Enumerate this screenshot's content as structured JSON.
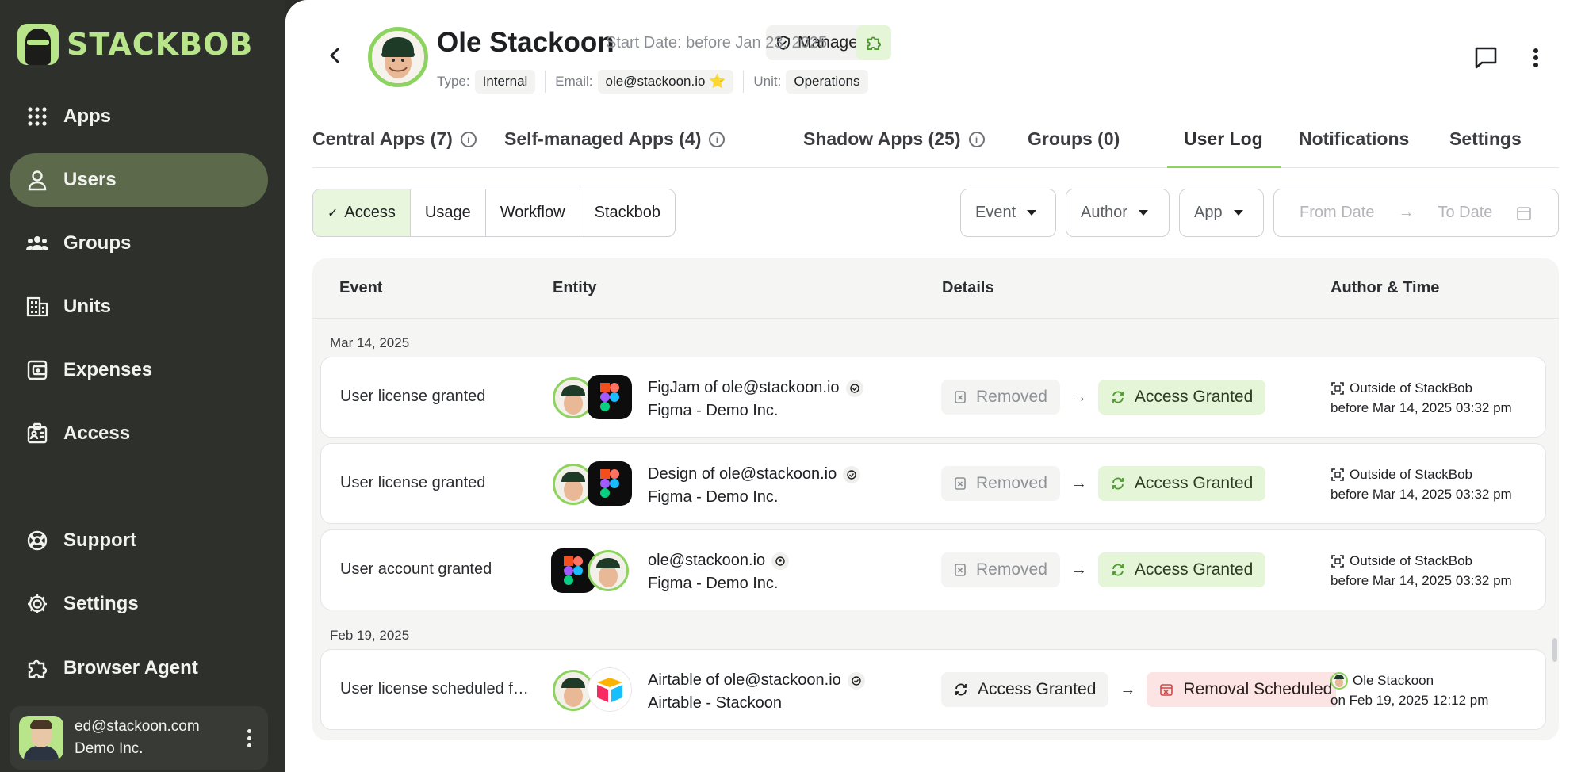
{
  "brand": {
    "name": "STACKBOB",
    "accent": "#b9e58a"
  },
  "sidebar": {
    "items": [
      {
        "label": "Apps",
        "icon": "apps-grid-icon"
      },
      {
        "label": "Users",
        "icon": "user-icon",
        "active": true
      },
      {
        "label": "Groups",
        "icon": "groups-icon"
      },
      {
        "label": "Units",
        "icon": "building-icon"
      },
      {
        "label": "Expenses",
        "icon": "wallet-icon"
      },
      {
        "label": "Access",
        "icon": "badge-icon"
      },
      {
        "label": "Support",
        "icon": "lifebuoy-icon"
      },
      {
        "label": "Settings",
        "icon": "gear-icon"
      },
      {
        "label": "Browser Agent",
        "icon": "puzzle-icon"
      }
    ],
    "account": {
      "email": "ed@stackoon.com",
      "org": "Demo Inc."
    }
  },
  "profile": {
    "name": "Ole Stackoon",
    "managed_label": "Managed",
    "start_date": "Start Date: before Jan 23, 2025",
    "type_label": "Type:",
    "type_value": "Internal",
    "email_label": "Email:",
    "email_value": "ole@stackoon.io ⭐",
    "unit_label": "Unit:",
    "unit_value": "Operations"
  },
  "tabs": [
    {
      "label": "Central Apps (7)",
      "info": true
    },
    {
      "label": "Self-managed Apps (4)",
      "info": true
    },
    {
      "label": "Shadow Apps (25)",
      "info": true
    },
    {
      "label": "Groups (0)",
      "info": false
    },
    {
      "label": "User Log",
      "info": false,
      "active": true
    },
    {
      "label": "Notifications",
      "info": false
    },
    {
      "label": "Settings",
      "info": false
    }
  ],
  "segments": [
    {
      "label": "Access",
      "active": true
    },
    {
      "label": "Usage"
    },
    {
      "label": "Workflow"
    },
    {
      "label": "Stackbob"
    }
  ],
  "filters": {
    "event": "Event",
    "author": "Author",
    "app": "App",
    "from": "From Date",
    "to": "To Date"
  },
  "table": {
    "headers": {
      "event": "Event",
      "entity": "Entity",
      "details": "Details",
      "author": "Author & Time"
    },
    "groups": [
      {
        "date": "Mar 14, 2025"
      },
      {
        "date": "Feb 19, 2025"
      }
    ],
    "rows": [
      {
        "event": "User license granted",
        "entity_name": "FigJam of ole@stackoon.io",
        "entity_sub": "Figma - Demo Inc.",
        "from": "Removed",
        "to": "Access Granted",
        "author": "Outside of StackBob",
        "time": "before Mar 14, 2025 03:32 pm"
      },
      {
        "event": "User license granted",
        "entity_name": "Design of ole@stackoon.io",
        "entity_sub": "Figma - Demo Inc.",
        "from": "Removed",
        "to": "Access Granted",
        "author": "Outside of StackBob",
        "time": "before Mar 14, 2025 03:32 pm"
      },
      {
        "event": "User account granted",
        "entity_name": "ole@stackoon.io",
        "entity_sub": "Figma - Demo Inc.",
        "from": "Removed",
        "to": "Access Granted",
        "author": "Outside of StackBob",
        "time": "before Mar 14, 2025 03:32 pm"
      },
      {
        "event": "User license scheduled f…",
        "entity_name": "Airtable of ole@stackoon.io",
        "entity_sub": "Airtable - Stackoon",
        "from": "Access Granted",
        "to": "Removal Scheduled",
        "author": "Ole Stackoon",
        "time": "on Feb 19, 2025 12:12 pm"
      }
    ]
  },
  "arrow": "→"
}
